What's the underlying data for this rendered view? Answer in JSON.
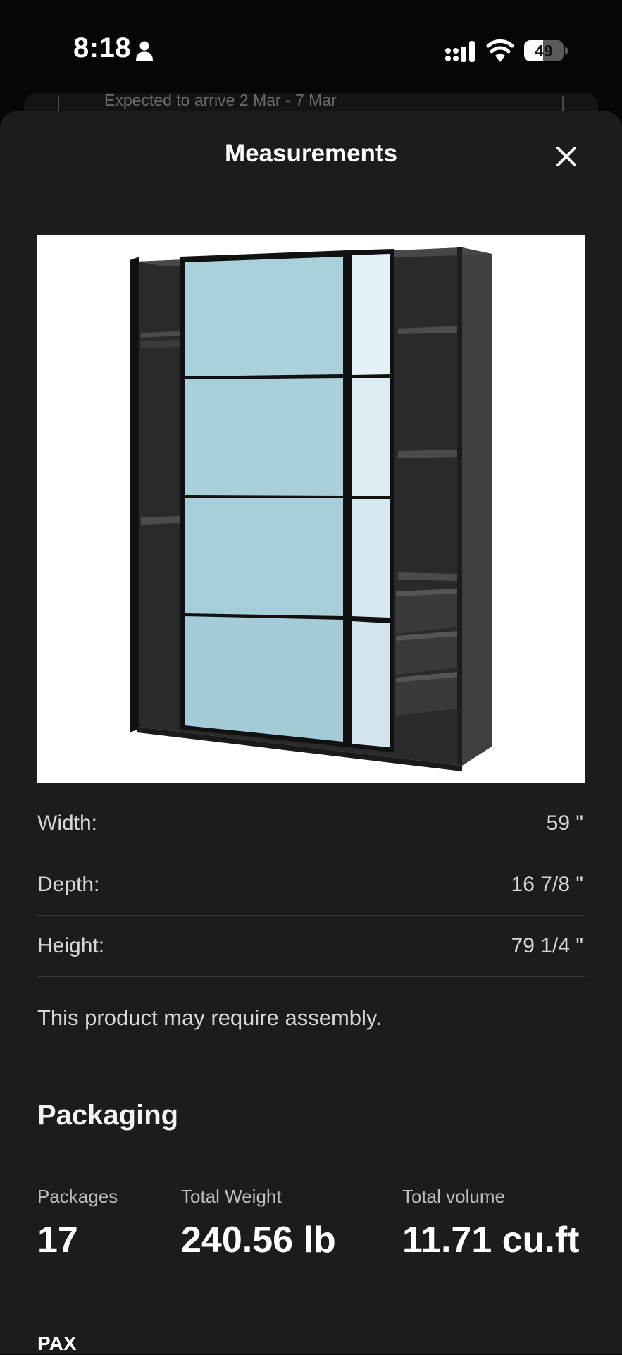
{
  "status_bar": {
    "time": "8:18",
    "battery_level": "49",
    "battery_fraction": 0.49,
    "icons": [
      "person-icon",
      "cellular-signal-icon",
      "wifi-icon",
      "battery-icon"
    ]
  },
  "background_card": {
    "delivery_text": "Expected to arrive 2 Mar - 7 Mar"
  },
  "sheet": {
    "title": "Measurements",
    "close_icon": "close-icon"
  },
  "product_image": {
    "alt": "PAX wardrobe with sliding doors"
  },
  "dimensions": [
    {
      "label": "Width:",
      "value": "59 \""
    },
    {
      "label": "Depth:",
      "value": "16 7/8 \""
    },
    {
      "label": "Height:",
      "value": "79 1/4 \""
    }
  ],
  "assembly_note": "This product may require assembly.",
  "packaging": {
    "heading": "Packaging",
    "stats": [
      {
        "label": "Packages",
        "value": "17"
      },
      {
        "label": "Total Weight",
        "value": "240.56 lb"
      },
      {
        "label": "Total volume",
        "value": "11.71 cu.ft"
      }
    ]
  },
  "next_section_heading": "PAX",
  "colors": {
    "sheet_background": "#1c1c1e",
    "page_background": "#060606",
    "divider": "#3a3a3c",
    "panel_blue": "#a9d0dc",
    "mirror": "#dfeef4"
  }
}
